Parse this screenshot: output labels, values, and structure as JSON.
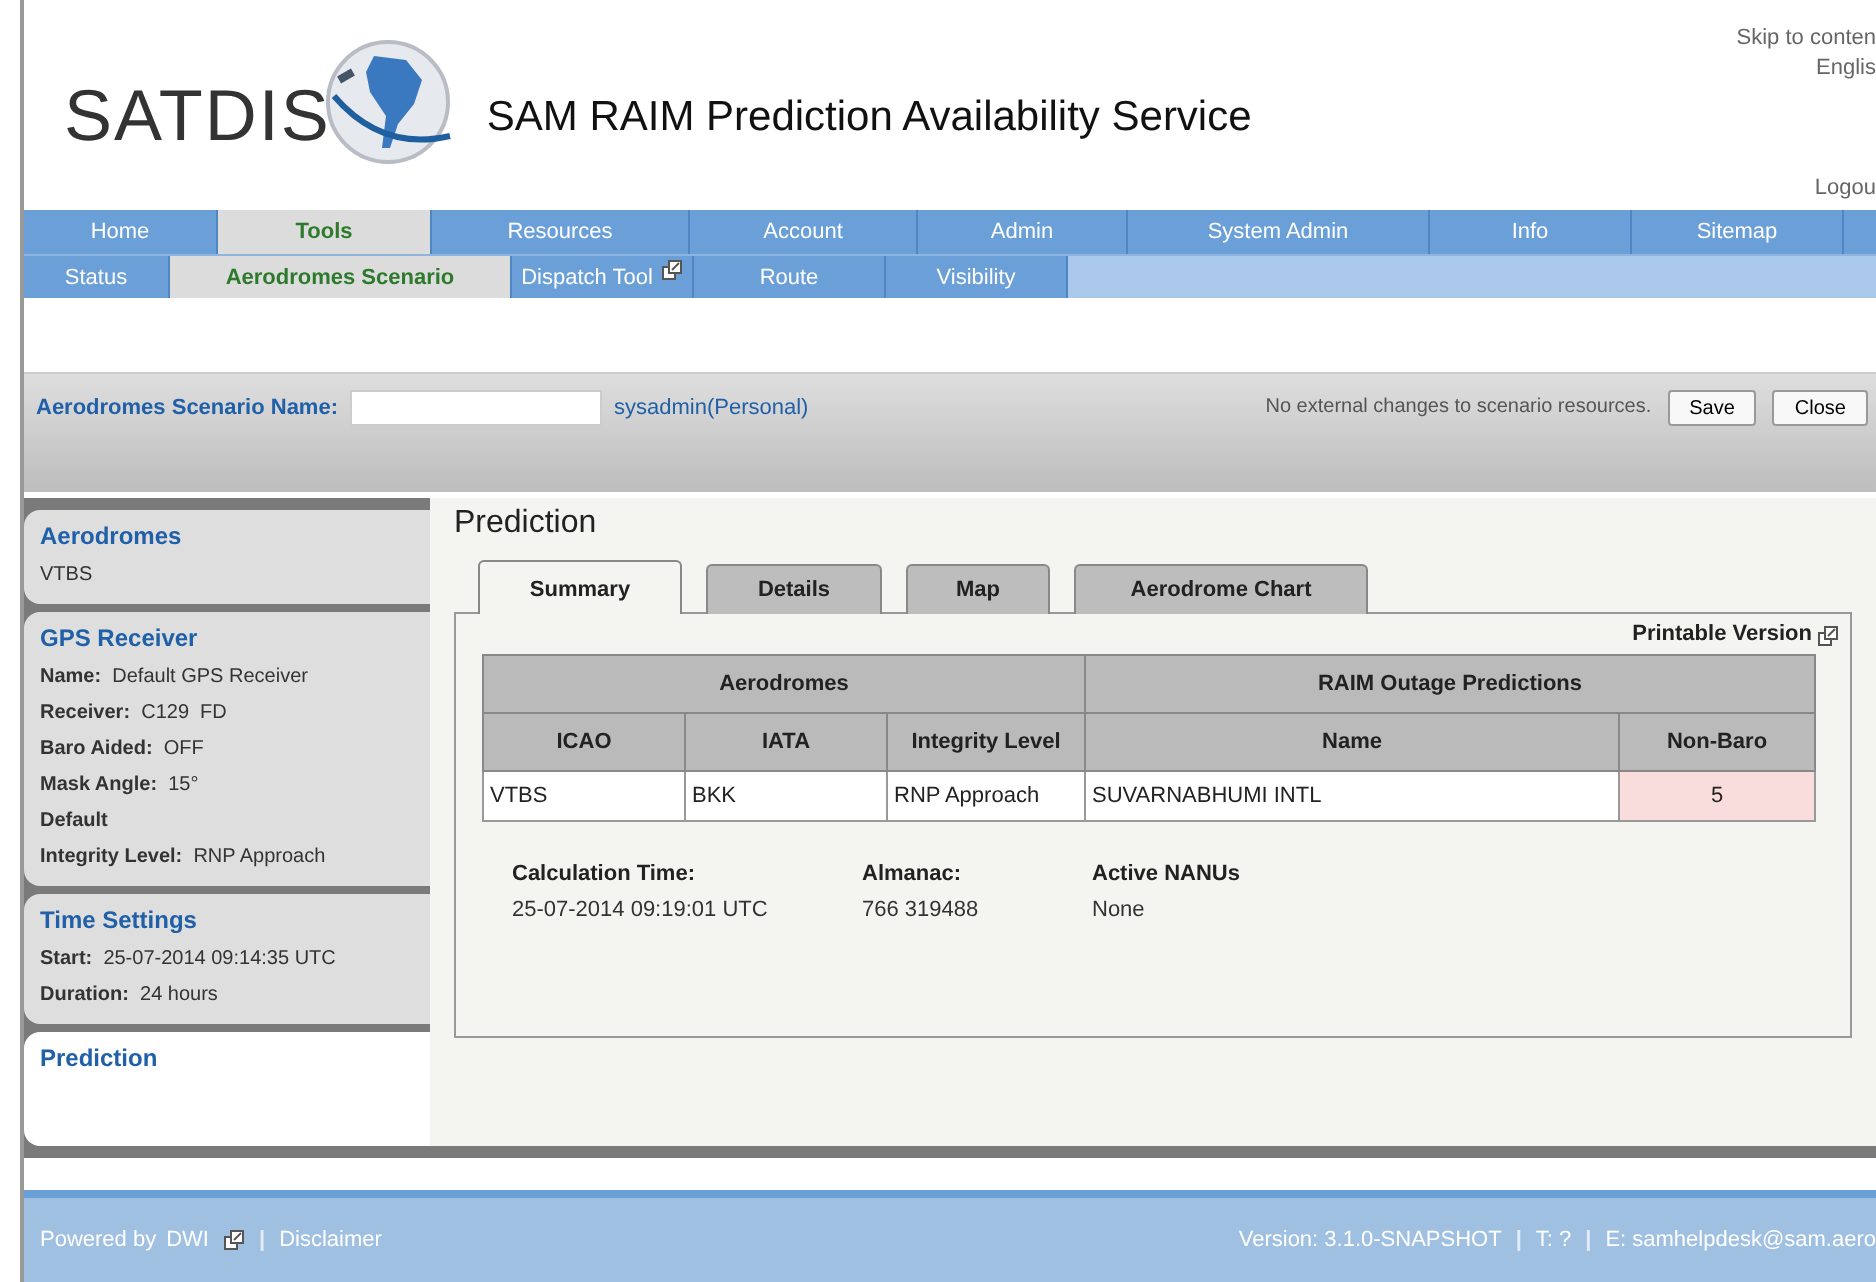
{
  "header": {
    "logo_text": "SATDIS",
    "title": "SAM RAIM Prediction Availability Service",
    "top_links": [
      "Skip to conten",
      "Englis"
    ],
    "logout": "Logou"
  },
  "nav": [
    {
      "label": "Home",
      "selected": false
    },
    {
      "label": "Tools",
      "selected": true
    },
    {
      "label": "Resources",
      "selected": false
    },
    {
      "label": "Account",
      "selected": false
    },
    {
      "label": "Admin",
      "selected": false
    },
    {
      "label": "System Admin",
      "selected": false
    },
    {
      "label": "Info",
      "selected": false
    },
    {
      "label": "Sitemap",
      "selected": false
    }
  ],
  "subnav": [
    {
      "label": "Status",
      "selected": false,
      "external": false
    },
    {
      "label": "Aerodromes Scenario",
      "selected": true,
      "external": false
    },
    {
      "label": "Dispatch Tool",
      "selected": false,
      "external": true
    },
    {
      "label": "Route",
      "selected": false,
      "external": false
    },
    {
      "label": "Visibility",
      "selected": false,
      "external": false
    }
  ],
  "scenario_bar": {
    "label": "Aerodromes Scenario Name:",
    "owner": "sysadmin(Personal)",
    "message": "No external changes to scenario resources.",
    "buttons": [
      "Save",
      "Close"
    ]
  },
  "sidebar": [
    {
      "title": "Aerodromes",
      "selected": false,
      "fields": [
        {
          "value": "VTBS"
        }
      ]
    },
    {
      "title": "GPS Receiver",
      "selected": false,
      "fields": [
        {
          "label": "Name:",
          "value": "Default GPS Receiver"
        },
        {
          "label": "Receiver:",
          "value": "C129  FD"
        },
        {
          "label": "Baro Aided:",
          "value": "OFF"
        },
        {
          "label": "Mask Angle:",
          "value": "15°"
        },
        {
          "label": "Default"
        },
        {
          "label": "Integrity Level:",
          "value": "RNP Approach"
        }
      ]
    },
    {
      "title": "Time Settings",
      "selected": false,
      "fields": [
        {
          "label": "Start:",
          "value": "25-07-2014 09:14:35 UTC"
        },
        {
          "label": "Duration:",
          "value": "24 hours"
        }
      ]
    },
    {
      "title": "Prediction",
      "selected": true
    }
  ],
  "main": {
    "heading": "Prediction",
    "tabs": [
      {
        "label": "Summary",
        "selected": true
      },
      {
        "label": "Details",
        "selected": false
      },
      {
        "label": "Map",
        "selected": false
      },
      {
        "label": "Aerodrome Chart",
        "selected": false
      }
    ],
    "printable": "Printable Version",
    "table": {
      "groups": [
        {
          "label": "Aerodromes",
          "columns": [
            "ICAO",
            "IATA",
            "Integrity Level"
          ]
        },
        {
          "label": "RAIM Outage Predictions",
          "columns": [
            "Name",
            "Non-Baro"
          ]
        }
      ],
      "rows": [
        {
          "cells": [
            {
              "text": "VTBS"
            },
            {
              "text": "BKK"
            },
            {
              "text": "RNP Approach"
            },
            {
              "text": "SUVARNABHUMI INTL"
            },
            {
              "text": "5",
              "color": "#f9dcdc"
            }
          ]
        }
      ]
    },
    "info": [
      {
        "label": "Calculation Time:",
        "value": "25-07-2014 09:19:01 UTC"
      },
      {
        "label": "Almanac:",
        "value": "766 319488"
      },
      {
        "label": "Active NANUs",
        "value": "None"
      }
    ]
  },
  "footer": {
    "left": [
      {
        "kind": "text",
        "text": "Powered by"
      },
      {
        "kind": "link",
        "text": "DWI",
        "external": true
      },
      {
        "kind": "separator",
        "text": "|"
      },
      {
        "kind": "link",
        "text": "Disclaimer",
        "external": false
      }
    ],
    "right": [
      {
        "kind": "text",
        "text": "Version: 3.1.0-SNAPSHOT"
      },
      {
        "kind": "separator",
        "text": "|"
      },
      {
        "kind": "text",
        "text": "T: ?"
      },
      {
        "kind": "separator",
        "text": "|"
      },
      {
        "kind": "text",
        "text": "E: samhelpdesk@sam.aero"
      }
    ]
  }
}
